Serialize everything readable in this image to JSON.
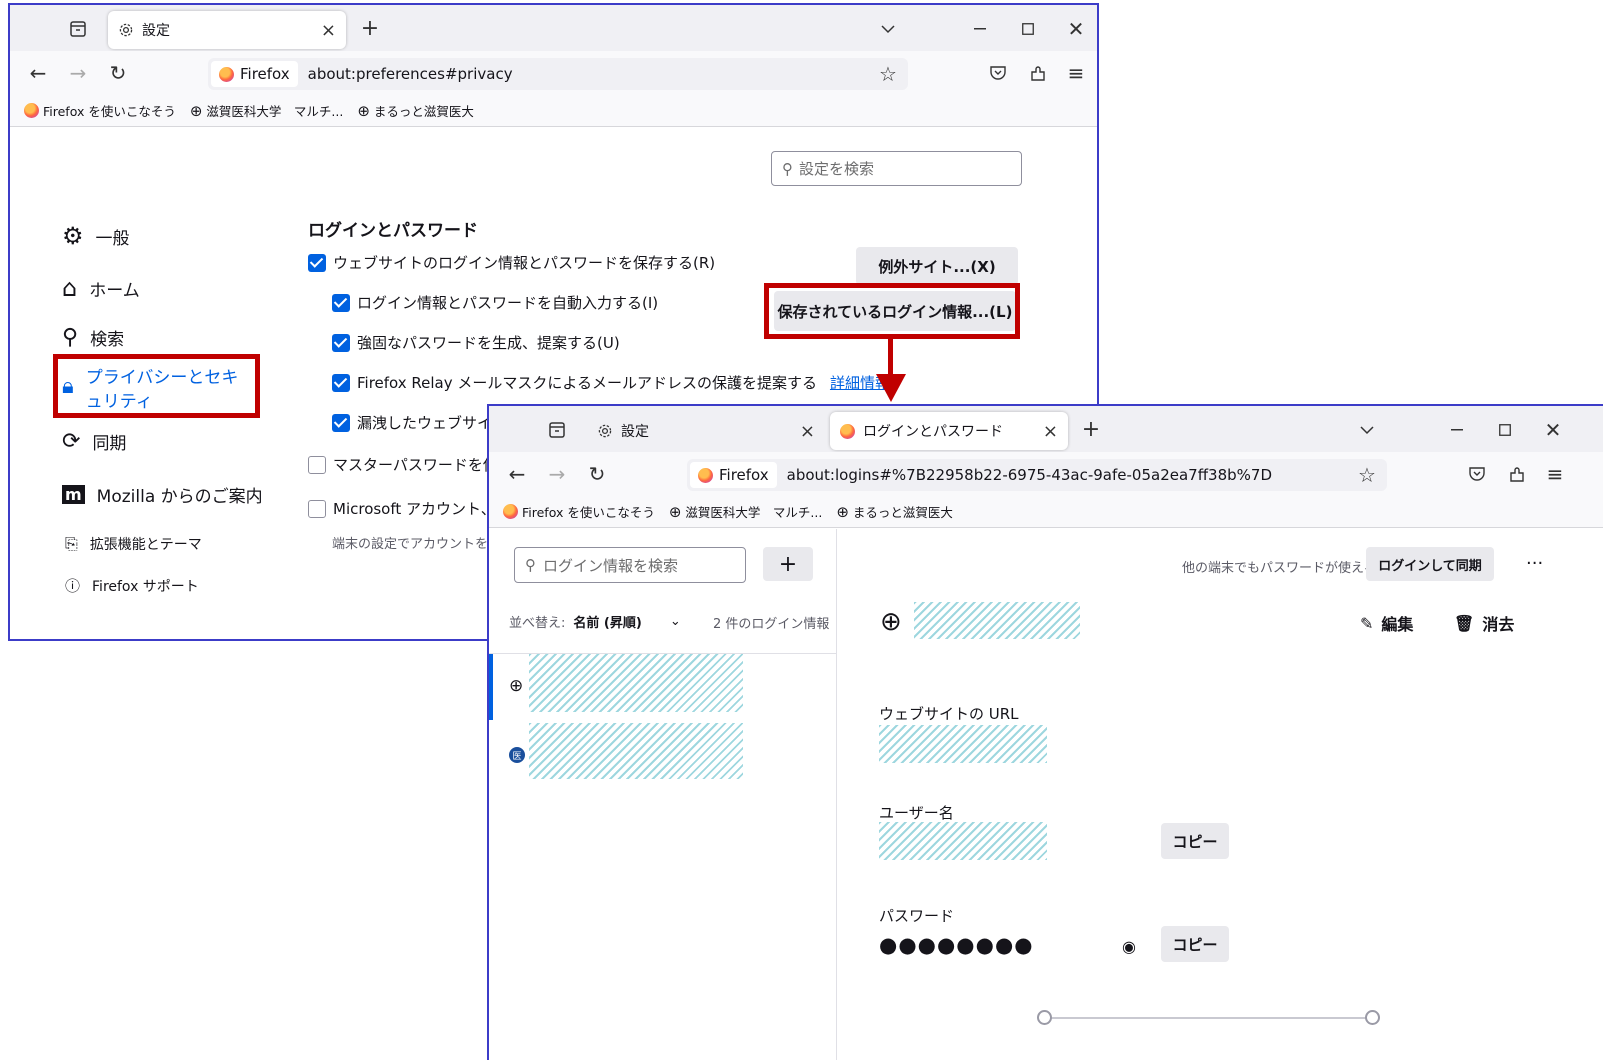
{
  "window1": {
    "tab_label": "設定",
    "url_identity": "Firefox",
    "url": "about:preferences#privacy",
    "bookmarks": [
      "Firefox を使いこなそう",
      "滋賀医科大学　マルチ...",
      "まるっと滋賀医大"
    ],
    "search_placeholder": "設定を検索",
    "nav": {
      "general": "一般",
      "home": "ホーム",
      "search": "検索",
      "privacy": "プライバシーとセキュリティ",
      "sync": "同期",
      "mozilla": "Mozilla からのご案内",
      "extensions": "拡張機能とテーマ",
      "support": "Firefox サポート"
    },
    "section_title": "ログインとパスワード",
    "options": {
      "save_logins": "ウェブサイトのログイン情報とパスワードを保存する(R)",
      "autofill": "ログイン情報とパスワードを自動入力する(I)",
      "generate": "強固なパスワードを生成、提案する(U)",
      "relay": "Firefox Relay メールマスクによるメールアドレスの保護を提案する",
      "relay_link": "詳細情報",
      "breach": "漏洩したウェブサイトの",
      "primary_password": "マスターパスワードを使用す",
      "microsoft": "Microsoft アカウント、職",
      "microsoft_note": "端末の設定でアカウントを管"
    },
    "buttons": {
      "exceptions": "例外サイト...(X)",
      "saved_logins": "保存されているログイン情報...(L)"
    }
  },
  "window2": {
    "tab1_label": "設定",
    "tab2_label": "ログインとパスワード",
    "url_identity": "Firefox",
    "url": "about:logins#%7B22958b22-6975-43ac-9afe-05a2ea7ff38b%7D",
    "bookmarks": [
      "Firefox を使いこなそう",
      "滋賀医科大学　マルチ...",
      "まるっと滋賀医大"
    ],
    "search_placeholder": "ログイン情報を検索",
    "add_label": "+",
    "sort_label": "並べ替え:",
    "sort_value": "名前 (昇順)",
    "count": "2 件のログイン情報",
    "sync_promo": "他の端末でもパスワードが使える",
    "sync_button": "ログインして同期",
    "more": "···",
    "edit": "編集",
    "delete": "消去",
    "url_label": "ウェブサイトの URL",
    "username_label": "ユーザー名",
    "password_label": "パスワード",
    "password_mask": "●●●●●●●●",
    "copy": "コピー",
    "list_badge": "医"
  },
  "colors": {
    "highlight": "#c00000",
    "window_border": "#3c3cc8",
    "accent": "#0061e0"
  }
}
